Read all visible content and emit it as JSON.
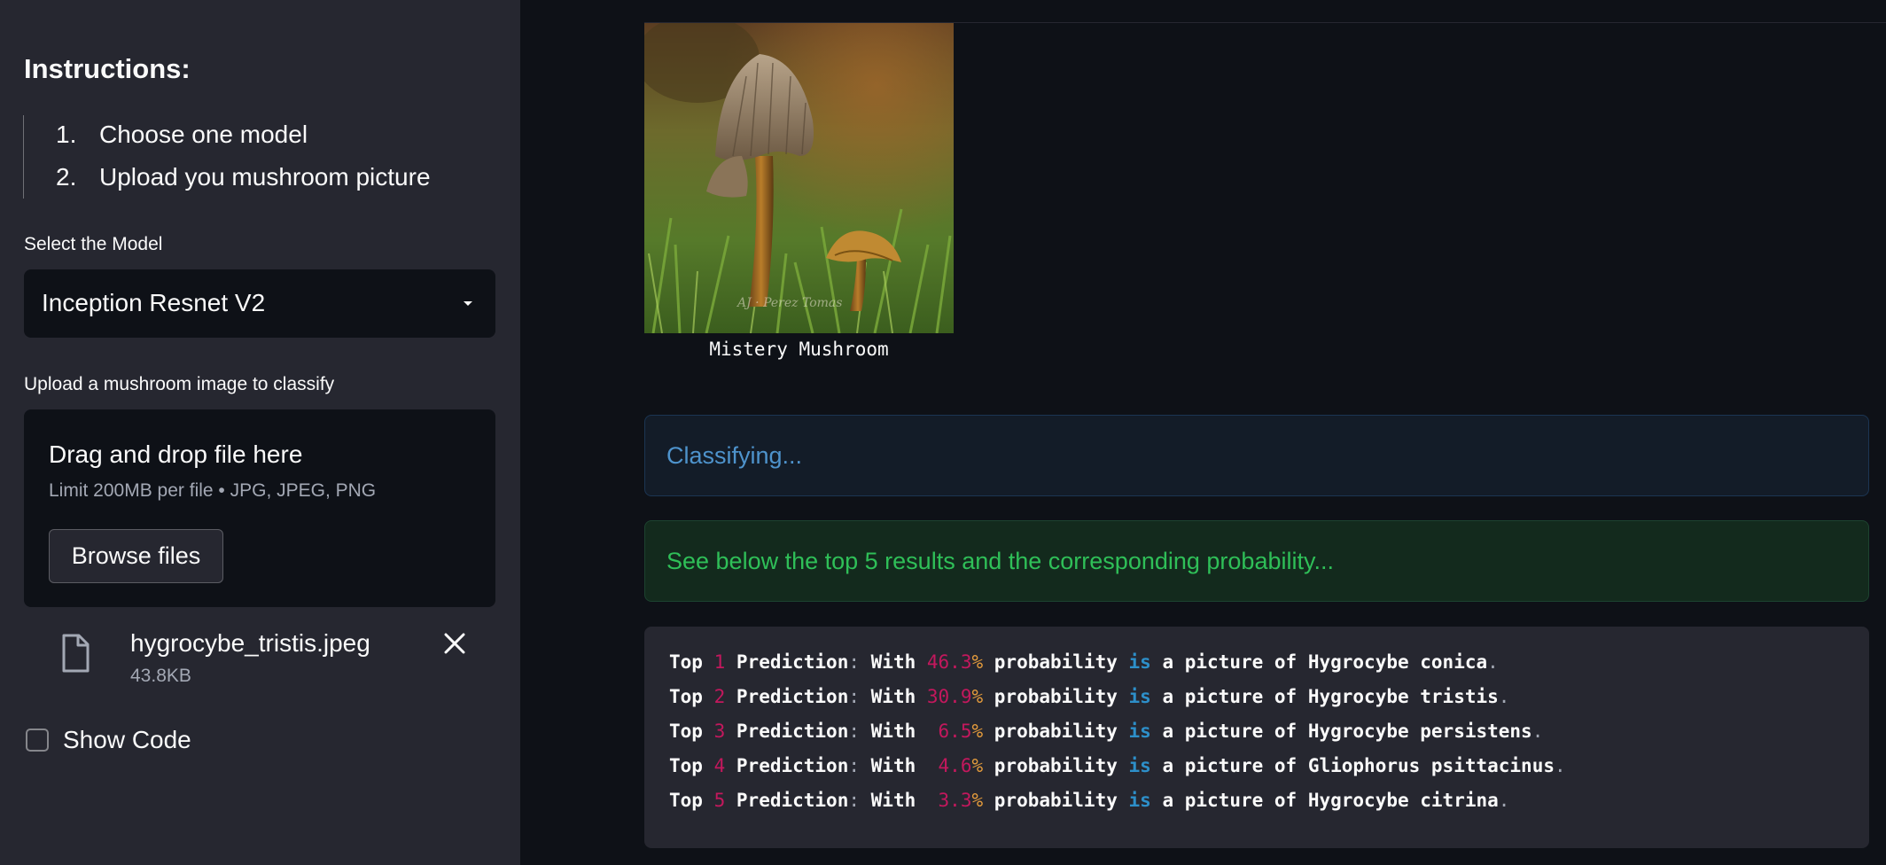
{
  "sidebar": {
    "instructions_title": "Instructions:",
    "steps": [
      {
        "num": "1.",
        "text": "Choose one model"
      },
      {
        "num": "2.",
        "text": "Upload you mushroom picture"
      }
    ],
    "model_label": "Select the Model",
    "model_selected": "Inception Resnet V2",
    "upload_label": "Upload a mushroom image to classify",
    "dropzone": {
      "title": "Drag and drop file here",
      "limit": "Limit 200MB per file • JPG, JPEG, PNG",
      "browse_label": "Browse files"
    },
    "file": {
      "name": "hygrocybe_tristis.jpeg",
      "size": "43.8KB"
    },
    "show_code_label": "Show Code"
  },
  "main": {
    "image_caption": "Mistery Mushroom",
    "info_alert": "Classifying...",
    "success_alert": "See below the top 5 results and the corresponding probability...",
    "predictions": [
      {
        "rank": "1",
        "prob": "46.3",
        "species": "Hygrocybe conica"
      },
      {
        "rank": "2",
        "prob": "30.9",
        "species": "Hygrocybe tristis"
      },
      {
        "rank": "3",
        "prob": " 6.5",
        "species": "Hygrocybe persistens"
      },
      {
        "rank": "4",
        "prob": " 4.6",
        "species": "Gliophorus psittacinus"
      },
      {
        "rank": "5",
        "prob": " 3.3",
        "species": "Hygrocybe citrina"
      }
    ],
    "code_words": {
      "top": "Top",
      "prediction": "Prediction",
      "colon": ":",
      "with": "With",
      "pct": "%",
      "probability": "probability",
      "is": "is",
      "a_picture_of": "a picture of",
      "period": "."
    }
  },
  "colors": {
    "sidebar_bg": "#262730",
    "main_bg": "#0e1117",
    "info_text": "#4e93cc",
    "success_text": "#2fbf58",
    "code_number": "#c3185d",
    "code_keyword": "#2d8fc9"
  }
}
